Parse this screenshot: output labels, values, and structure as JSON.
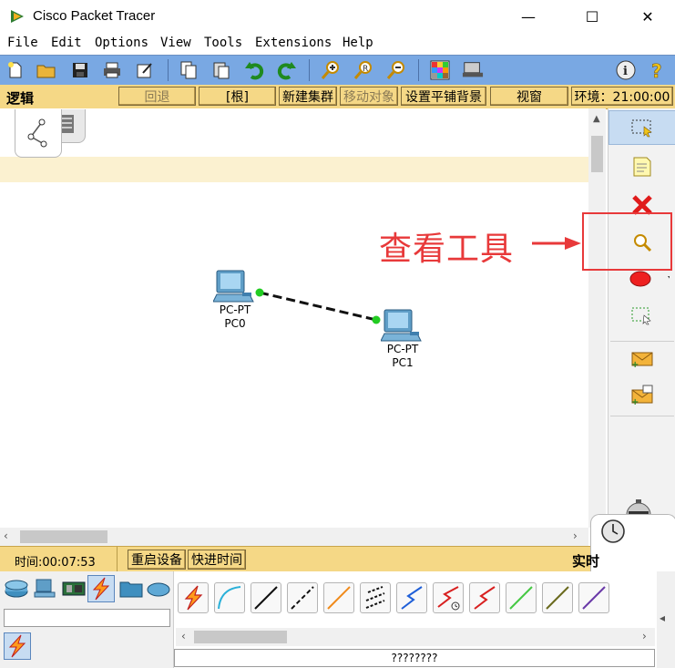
{
  "window": {
    "title": "Cisco Packet Tracer",
    "minimize_glyph": "—",
    "maximize_glyph": "☐",
    "close_glyph": "✕"
  },
  "menu": [
    "File",
    "Edit",
    "Options",
    "View",
    "Tools",
    "Extensions",
    "Help"
  ],
  "toolbar": {
    "icons": [
      "new-icon",
      "open-icon",
      "save-icon",
      "print-icon",
      "activity-wizard-icon",
      "copy-icon",
      "paste-icon",
      "undo-icon",
      "redo-icon",
      "zoom-in-icon",
      "zoom-reset-icon",
      "zoom-out-icon",
      "palette-icon",
      "custom-device-icon",
      "info-icon",
      "help-icon"
    ]
  },
  "logical_bar": {
    "label": "逻辑",
    "back": "回退",
    "root": "[根]",
    "new_cluster": "新建集群",
    "move_object": "移动对象",
    "set_tiled_bg": "设置平铺背景",
    "viewport": "视窗",
    "environment": "环境：21:00:00"
  },
  "devices": [
    {
      "type": "PC-PT",
      "name": "PC0"
    },
    {
      "type": "PC-PT",
      "name": "PC1"
    }
  ],
  "annotation": {
    "text": "查看工具",
    "color": "#e8393a"
  },
  "right_tools": [
    "select-icon",
    "note-icon",
    "delete-icon",
    "inspect-icon",
    "shape-icon",
    "resize-icon",
    "add-simple-pdu-icon",
    "add-complex-pdu-icon"
  ],
  "realtime_bar": {
    "time": "时间:00:07:53",
    "power_cycle": "重启设备",
    "fast_forward": "快进时间",
    "mode": "实时"
  },
  "bottom": {
    "status_text": "????????",
    "cable_colors": [
      "#e03a2a",
      "#2ab0d8",
      "#111111",
      "#111111",
      "#f08a1a",
      "#111111",
      "#1f5fd8",
      "#d81f1f",
      "#d81f1f",
      "#46c844",
      "#6a6a1e",
      "#6a3aa8"
    ]
  },
  "colors": {
    "toolbar": "#79a8e3",
    "bar_yellow": "#f5d886",
    "link_green": "#22cc22",
    "annotation_red": "#e8393a"
  }
}
